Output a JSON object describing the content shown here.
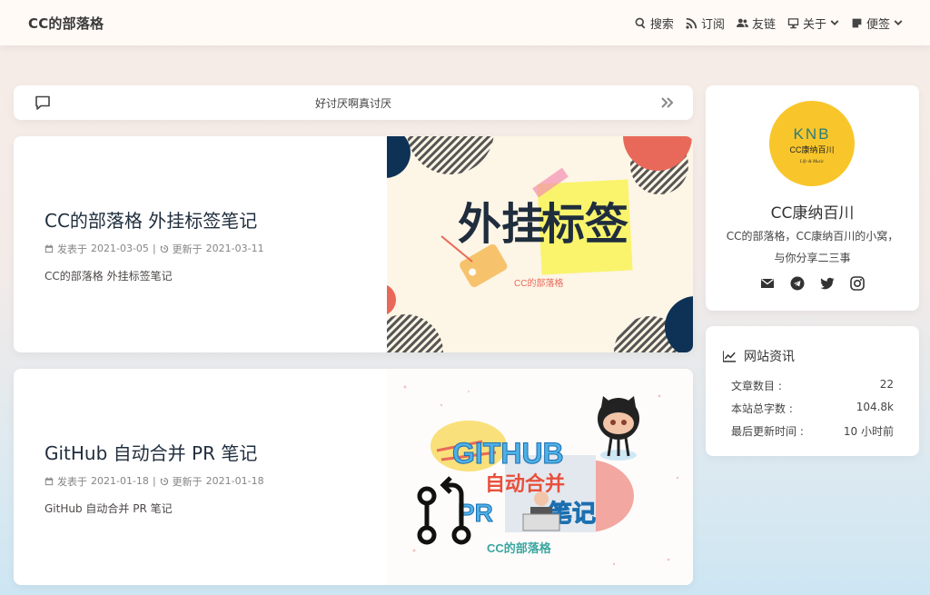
{
  "nav": {
    "site_title": "CC的部落格",
    "items": [
      {
        "label": "搜索",
        "icon": "search-icon"
      },
      {
        "label": "订阅",
        "icon": "rss-icon"
      },
      {
        "label": "友链",
        "icon": "users-icon"
      },
      {
        "label": "关于",
        "icon": "desktop-icon",
        "dropdown": true
      },
      {
        "label": "便签",
        "icon": "sticky-note-icon",
        "dropdown": true
      }
    ]
  },
  "announcement": {
    "text": "好讨厌啊真讨厌"
  },
  "posts": [
    {
      "title": "CC的部落格 外挂标签笔记",
      "published_label": "发表于",
      "published": "2021-03-05",
      "updated_label": "更新于",
      "updated": "2021-03-11",
      "excerpt": "CC的部落格 外挂标签笔记",
      "cover_title_part1": "外挂",
      "cover_title_part2": "标签",
      "cover_caption": "CC的部落格"
    },
    {
      "title": "GitHub 自动合并 PR 笔记",
      "published_label": "发表于",
      "published": "2021-01-18",
      "updated_label": "更新于",
      "updated": "2021-01-18",
      "excerpt": "GitHub 自动合并 PR 笔记",
      "cover_line1": "GITHUB",
      "cover_line2": "自动合并",
      "cover_line3a": "PR",
      "cover_line3b": "笔记",
      "cover_caption": "CC的部落格"
    }
  ],
  "meta_separator": "|",
  "author": {
    "avatar_logo": "KNB",
    "avatar_sub": "CC康纳百川",
    "avatar_tagline": "Life & Music",
    "name": "CC康纳百川",
    "desc_line1": "CC的部落格，CC康纳百川的小窝，",
    "desc_line2": "与你分享二三事",
    "socials": [
      "email-icon",
      "telegram-icon",
      "twitter-icon",
      "instagram-icon"
    ]
  },
  "site_info": {
    "heading": "网站资讯",
    "rows": [
      {
        "label": "文章数目 :",
        "value": "22"
      },
      {
        "label": "本站总字数 :",
        "value": "104.8k"
      },
      {
        "label": "最后更新时间 :",
        "value": "10 小时前"
      }
    ]
  },
  "colors": {
    "title": "#1f2d3d",
    "avatar_bg": "#f8c62b",
    "accent_red": "#e8695a",
    "navy": "#0d3255"
  }
}
